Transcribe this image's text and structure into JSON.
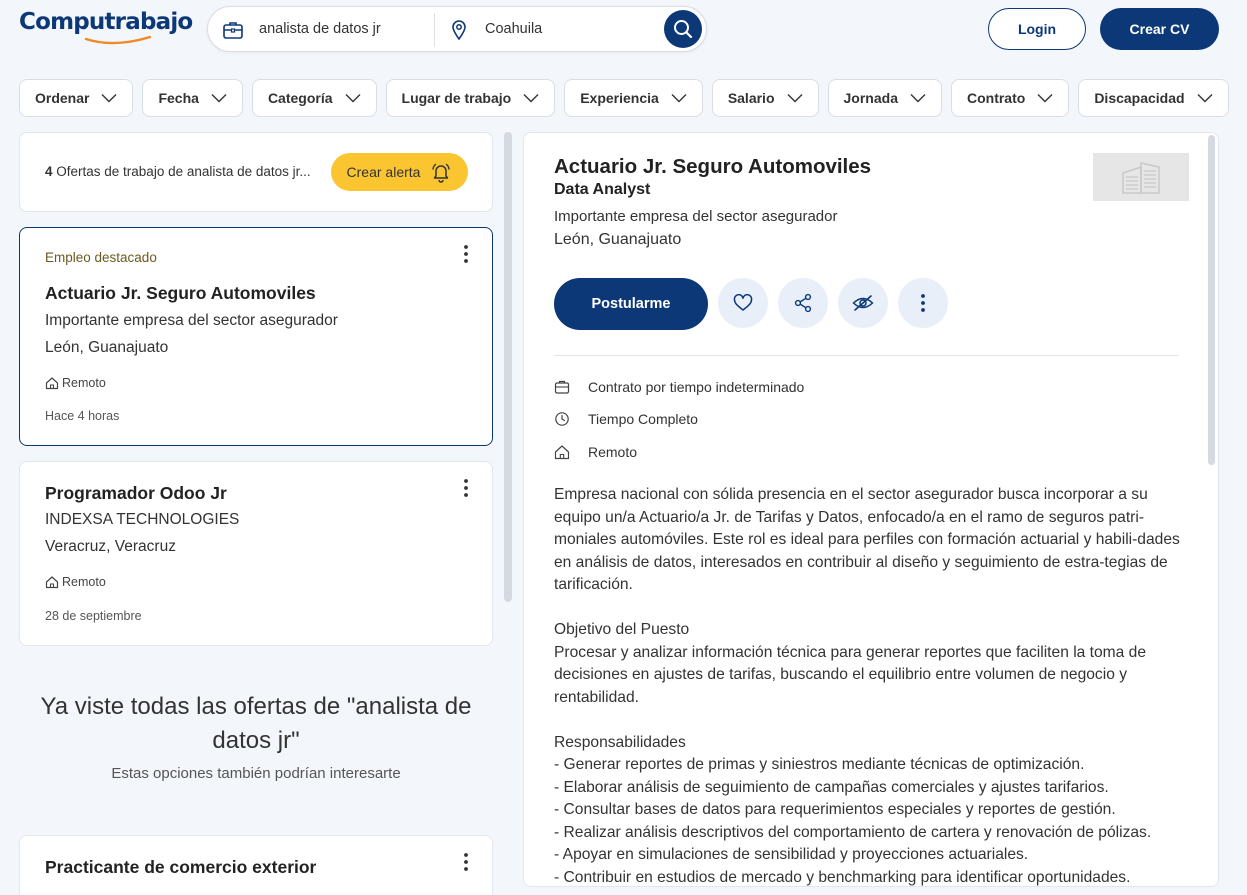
{
  "header": {
    "logo": "Computrabajo",
    "search_keyword": "analista de datos jr",
    "search_location": "Coahuila",
    "login_label": "Login",
    "cv_label": "Crear CV"
  },
  "filters": [
    "Ordenar",
    "Fecha",
    "Categoría",
    "Lugar de trabajo",
    "Experiencia",
    "Salario",
    "Jornada",
    "Contrato",
    "Discapacidad"
  ],
  "results": {
    "count": "4",
    "text": " Ofertas de trabajo de analista de datos jr...",
    "alert_label": "Crear alerta"
  },
  "jobs": [
    {
      "featured": "Empleo destacado",
      "title": "Actuario Jr. Seguro Automoviles",
      "company": "Importante empresa del sector asegurador",
      "location": "León, Guanajuato",
      "mode": "Remoto",
      "posted": "Hace 4 horas"
    },
    {
      "title": "Programador Odoo Jr",
      "company": "INDEXSA TECHNOLOGIES",
      "location": "Veracruz, Veracruz",
      "mode": "Remoto",
      "posted": "28 de septiembre"
    },
    {
      "title": "Practicante de comercio exterior"
    }
  ],
  "end_message": "Ya viste todas las ofertas de \"analista de datos jr\"",
  "end_sub": "Estas opciones también podrían interesarte",
  "detail": {
    "title": "Actuario Jr. Seguro Automoviles",
    "subtitle": "Data Analyst",
    "company": "Importante empresa del sector asegurador",
    "location": "León, Guanajuato",
    "apply_label": "Postularme",
    "attributes": {
      "contract": "Contrato por tiempo indeterminado",
      "schedule": "Tiempo Completo",
      "mode": "Remoto"
    },
    "description": "Empresa nacional con sólida presencia en el sector asegurador busca incorporar a su equipo un/a Actuario/a Jr. de Tarifas y Datos, enfocado/a en el ramo de seguros patri-moniales automóviles. Este rol es ideal para perfiles con formación actuarial y habili-dades en análisis de datos, interesados en contribuir al diseño y seguimiento de estra-tegias de tarificación.\n\nObjetivo del Puesto\nProcesar y analizar información técnica para generar reportes que faciliten la toma de decisiones en ajustes de tarifas, buscando el equilibrio entre volumen de negocio y rentabilidad.\n\nResponsabilidades\n- Generar reportes de primas y siniestros mediante técnicas de optimización.\n- Elaborar análisis de seguimiento de campañas comerciales y ajustes tarifarios.\n- Consultar bases de datos para requerimientos especiales y reportes de gestión.\n- Realizar análisis descriptivos del comportamiento de cartera y renovación de pólizas.\n- Apoyar en simulaciones de sensibilidad y proyecciones actuariales.\n- Contribuir en estudios de mercado y benchmarking para identificar oportunidades."
  },
  "colors": {
    "brand_navy": "#0d3878",
    "alert_yellow": "#fbc531",
    "logo_orange": "#f08a24"
  },
  "icons": [
    "briefcase-icon",
    "location-pin-icon",
    "search-icon",
    "chevron-down-icon",
    "bell-icon",
    "kebab-menu-icon",
    "home-icon",
    "heart-icon",
    "share-icon",
    "hide-eye-icon",
    "clock-icon",
    "company-logo-icon"
  ]
}
